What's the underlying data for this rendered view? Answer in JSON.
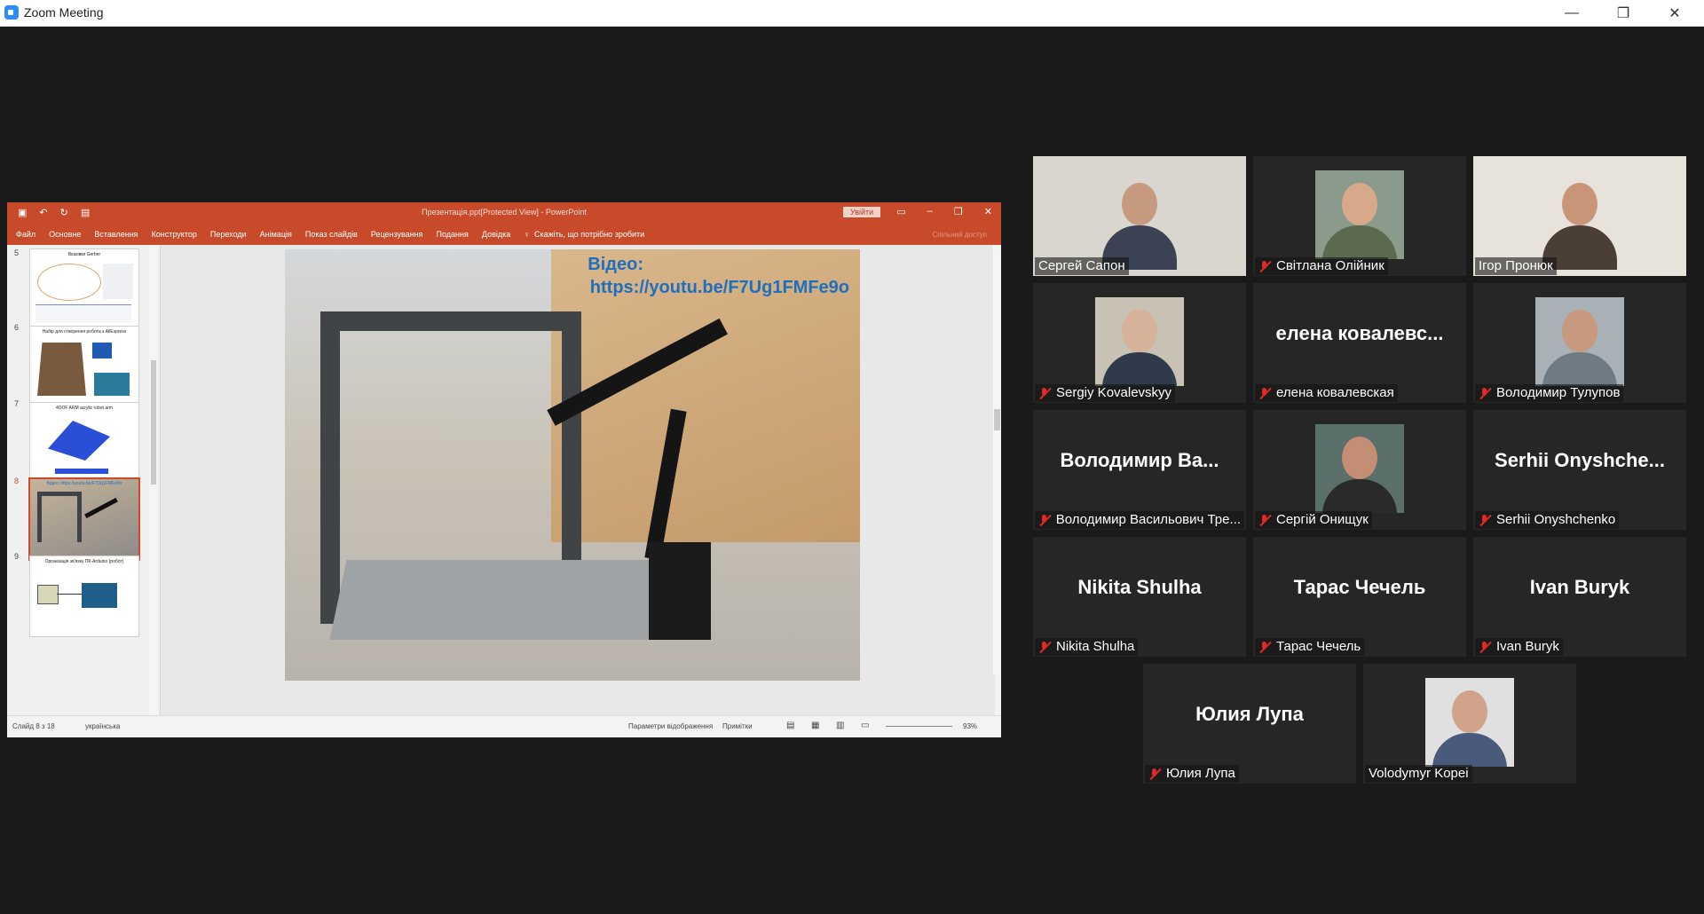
{
  "window": {
    "title": "Zoom Meeting",
    "minimize": "—",
    "restore": "❐",
    "close": "✕"
  },
  "powerpoint": {
    "doc_title": "Презентація.ppt[Protected View]  -  PowerPoint",
    "signin": "Увійти",
    "menu": [
      "Файл",
      "Основне",
      "Вставлення",
      "Конструктор",
      "Переходи",
      "Анімація",
      "Показ слайдів",
      "Рецензування",
      "Подання",
      "Довідка",
      "Скажіть, що потрібно зробити"
    ],
    "share_label": "Спільний доступ",
    "thumbnails": [
      {
        "num": "5",
        "caption": "Вказівки Gerber"
      },
      {
        "num": "6",
        "caption": "Набір для створення робота з AliExpress"
      },
      {
        "num": "7",
        "caption": "4DOF ARM acrylic robot arm"
      },
      {
        "num": "8",
        "caption": "Відео: https://youtu.be/F7Ug1FMFe9o"
      },
      {
        "num": "9",
        "caption": "Організація зв'язку ПК-Arduino (робот)"
      }
    ],
    "slide": {
      "line1": "Відео:",
      "line2": "https://youtu.be/F7Ug1FMFe9o"
    },
    "status": {
      "slide_of": "Слайд 8 з 18",
      "language": "українська",
      "display_settings": "Параметри відображення",
      "notes": "Примітки",
      "zoom": "93%"
    }
  },
  "participants": [
    {
      "name": "Сергей Сапон",
      "muted": false,
      "video": true,
      "skin": "#c59a7f",
      "shirt": "#3a4253",
      "bg": "#d9d6cf"
    },
    {
      "name": "Світлана Олійник",
      "muted": true,
      "video": true,
      "skin": "#d7a98a",
      "shirt": "#5b6a4f",
      "bg": "#8a9a8b"
    },
    {
      "name": "Ігор Пронюк",
      "muted": false,
      "video": true,
      "skin": "#c99578",
      "shirt": "#4a3e36",
      "bg": "#e7e3da",
      "active": true
    },
    {
      "name": "Sergiy Kovalevskyy",
      "muted": true,
      "video": true,
      "skin": "#d7b29a",
      "shirt": "#2f3a4a",
      "bg": "#c8c2b5"
    },
    {
      "name": "елена ковалевская",
      "muted": true,
      "video": false,
      "display": "елена  ковалевс..."
    },
    {
      "name": "Володимир Тулупов",
      "muted": true,
      "video": true,
      "skin": "#c79a80",
      "shirt": "#6f7a83",
      "bg": "#a9b0b6"
    },
    {
      "name": "Володимир Васильович Тре...",
      "muted": true,
      "video": false,
      "display": "Володимир  Ва..."
    },
    {
      "name": "Сергій Онищук",
      "muted": true,
      "video": true,
      "skin": "#c38e73",
      "shirt": "#2a2a2a",
      "bg": "#5a6e6a"
    },
    {
      "name": "Serhii Onyshchenko",
      "muted": true,
      "video": false,
      "display": "Serhii  Onyshche..."
    },
    {
      "name": "Nikita Shulha",
      "muted": true,
      "video": false,
      "display": "Nikita Shulha"
    },
    {
      "name": "Тарас Чечель",
      "muted": true,
      "video": false,
      "display": "Тарас Чечель"
    },
    {
      "name": "Ivan Buryk",
      "muted": true,
      "video": false,
      "display": "Ivan Buryk"
    },
    {
      "name": "Юлия Лупа",
      "muted": true,
      "video": false,
      "display": "Юлия Лупа"
    },
    {
      "name": "Volodymyr Kopei",
      "muted": false,
      "video": true,
      "skin": "#d1a38a",
      "shirt": "#4a5a7a",
      "bg": "#e0e0e0"
    }
  ]
}
